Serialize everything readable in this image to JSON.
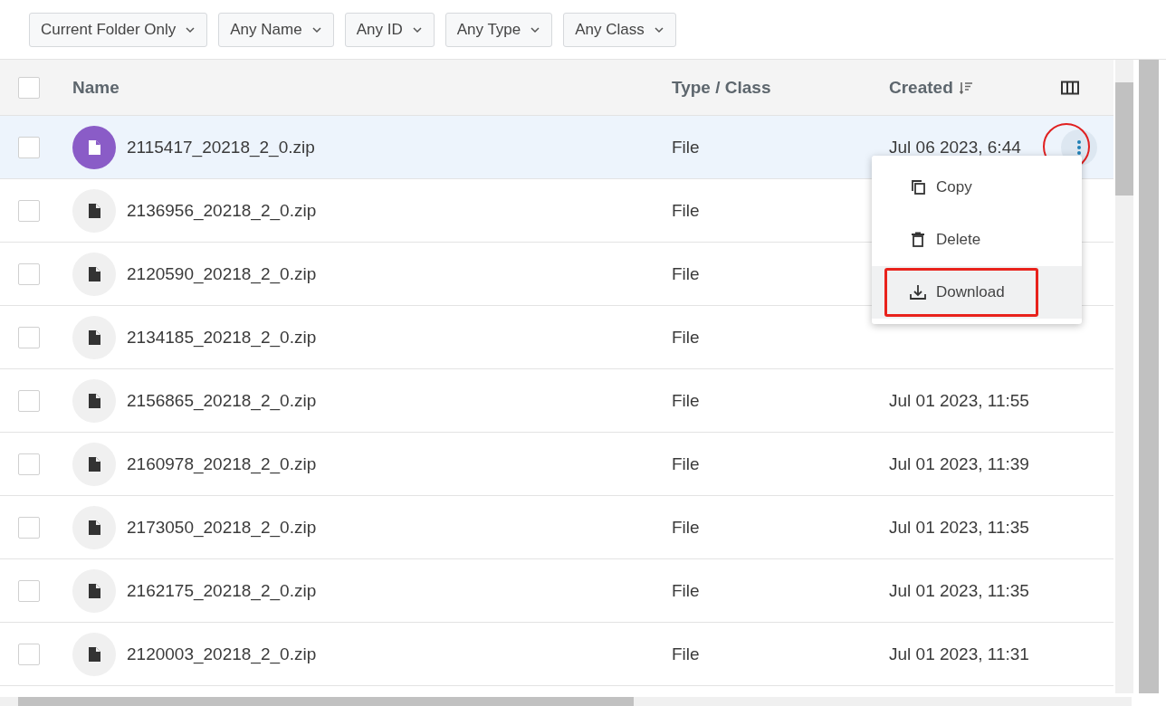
{
  "filters": [
    "Current Folder Only",
    "Any Name",
    "Any ID",
    "Any Type",
    "Any Class"
  ],
  "table": {
    "select_all_checked": false,
    "columns": [
      {
        "label": "Name"
      },
      {
        "label": "Type / Class"
      },
      {
        "label": "Created",
        "sorted": true
      }
    ],
    "rows": [
      {
        "name": "2115417_20218_2_0.zip",
        "type": "File",
        "created": "Jul 06 2023, 6:44",
        "selected": true
      },
      {
        "name": "2136956_20218_2_0.zip",
        "type": "File",
        "selected": false
      },
      {
        "name": "2120590_20218_2_0.zip",
        "type": "File",
        "selected": false
      },
      {
        "name": "2134185_20218_2_0.zip",
        "type": "File",
        "selected": false
      },
      {
        "name": "2156865_20218_2_0.zip",
        "type": "File",
        "created": "Jul 01 2023, 11:55",
        "selected": false
      },
      {
        "name": "2160978_20218_2_0.zip",
        "type": "File",
        "created": "Jul 01 2023, 11:39",
        "selected": false
      },
      {
        "name": "2173050_20218_2_0.zip",
        "type": "File",
        "created": "Jul 01 2023, 11:35",
        "selected": false
      },
      {
        "name": "2162175_20218_2_0.zip",
        "type": "File",
        "created": "Jul 01 2023, 11:35",
        "selected": false
      },
      {
        "name": "2120003_20218_2_0.zip",
        "type": "File",
        "created": "Jul 01 2023, 11:31",
        "selected": false
      }
    ]
  },
  "context_menu": {
    "items": [
      {
        "label": "Copy",
        "kind": "copy",
        "selected": false
      },
      {
        "label": "Delete",
        "kind": "delete",
        "selected": false
      },
      {
        "label": "Download",
        "kind": "download",
        "selected": true,
        "highlighted_box": true
      }
    ]
  },
  "more_button_circled": true
}
